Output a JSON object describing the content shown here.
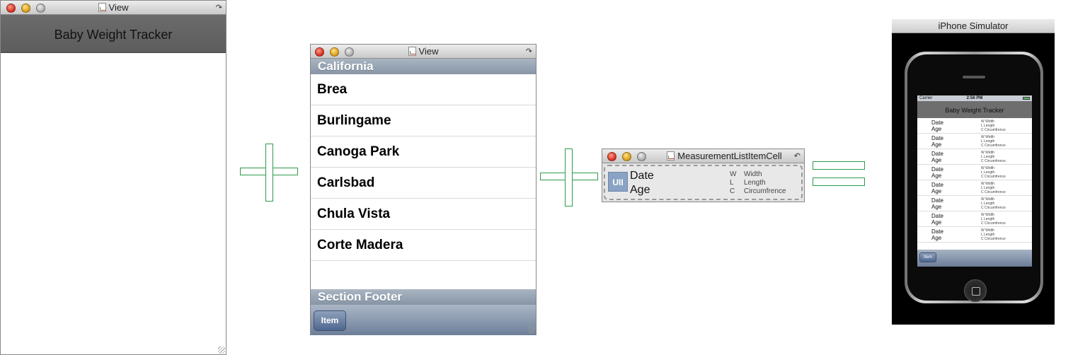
{
  "window1": {
    "title": "View",
    "nav_title": "Baby Weight Tracker"
  },
  "window2": {
    "title": "View",
    "section_header": "California",
    "rows": [
      "Brea",
      "Burlingame",
      "Canoga Park",
      "Carlsbad",
      "Chula Vista",
      "Corte Madera"
    ],
    "section_footer": "Section Footer",
    "toolbar_item": "Item"
  },
  "window3": {
    "title": "MeasurementListItemCell",
    "image_label": "UII",
    "date": "Date",
    "age": "Age",
    "measures": [
      {
        "key": "W",
        "label": "Width"
      },
      {
        "key": "L",
        "label": "Length"
      },
      {
        "key": "C",
        "label": "Circumfrence"
      }
    ]
  },
  "simulator": {
    "title": "iPhone Simulator",
    "carrier": "Carrier",
    "time": "2:56 PM",
    "nav_title": "Baby Weight Tracker",
    "row_date": "Date",
    "row_age": "Age",
    "row_measures": [
      "W  Width",
      "L  Length",
      "C  Circumfrence"
    ],
    "toolbar_item": "Item"
  },
  "colors": {
    "operator_green": "#2e9a4a",
    "nav_gray": "#666666",
    "toolbar_blue": "#6d7f98"
  }
}
